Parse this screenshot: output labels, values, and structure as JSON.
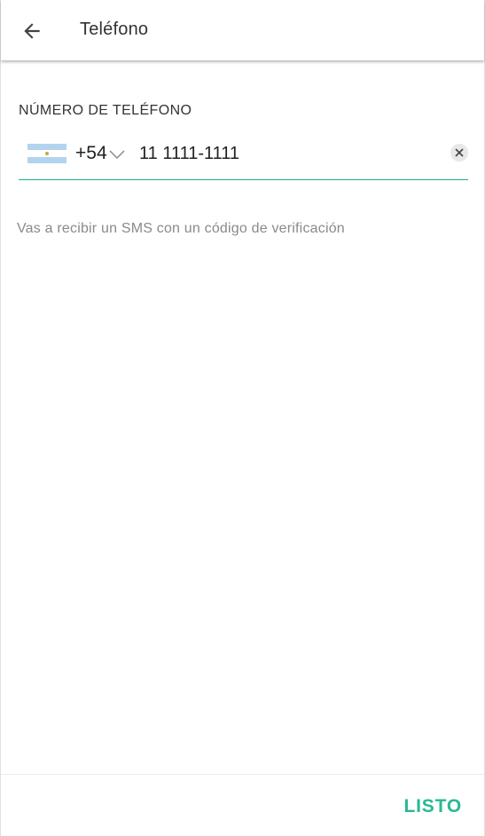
{
  "app_bar": {
    "title": "Teléfono",
    "back_icon": "arrow-back-icon"
  },
  "phone_field": {
    "label": "NÚMERO DE TELÉFONO",
    "country_flag": "argentina-flag-icon",
    "country_code": "+54",
    "value": "11 1111-1111",
    "clear_icon": "clear-icon",
    "dropdown_icon": "chevron-down-icon"
  },
  "helper": {
    "text": "Vas a recibir un SMS con un código de verificación"
  },
  "footer": {
    "done_label": "LISTO"
  },
  "colors": {
    "accent": "#27ba92",
    "underline": "#1fae8c",
    "flag_blue": "#b3d4ee",
    "flag_white": "#ffffff",
    "flag_sun": "#c8a94a"
  }
}
